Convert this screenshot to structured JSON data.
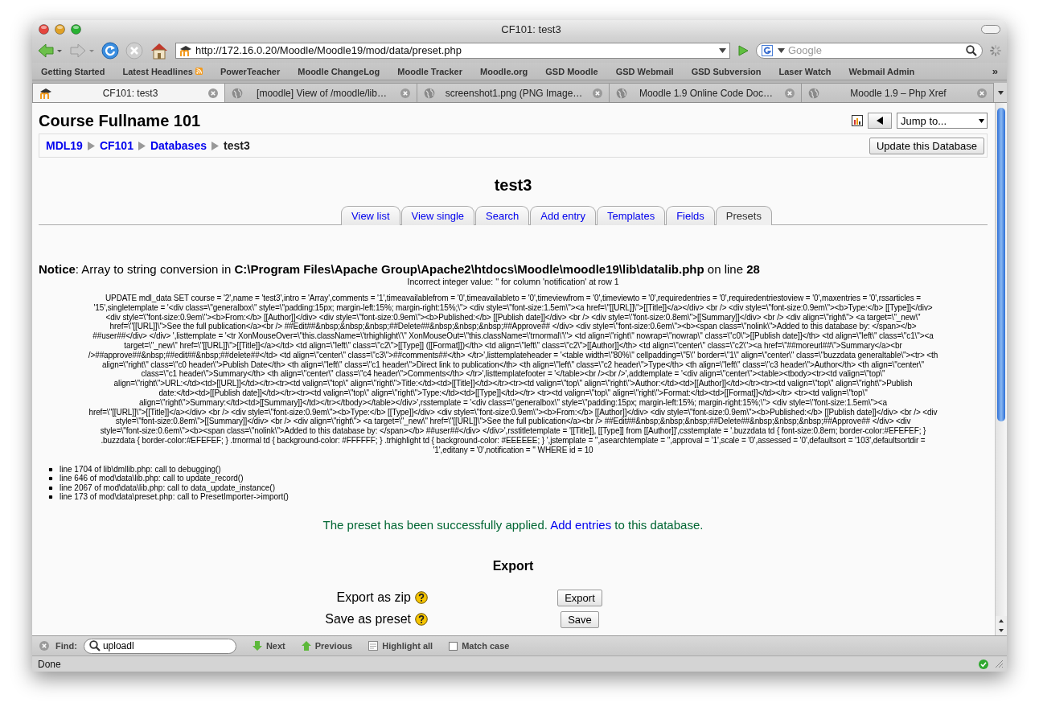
{
  "window": {
    "title": "CF101: test3"
  },
  "toolbar": {
    "url": "http://172.16.0.20/Moodle/Moodle19/mod/data/preset.php",
    "search": {
      "placeholder": "Google"
    }
  },
  "bookmarks": [
    {
      "label": "Getting Started",
      "kind": "link"
    },
    {
      "label": "Latest Headlines",
      "kind": "feed"
    },
    {
      "label": "PowerTeacher",
      "kind": "link"
    },
    {
      "label": "Moodle ChangeLog",
      "kind": "link"
    },
    {
      "label": "Moodle Tracker",
      "kind": "link"
    },
    {
      "label": "Moodle.org",
      "kind": "link"
    },
    {
      "label": "GSD Moodle",
      "kind": "link"
    },
    {
      "label": "GSD Webmail",
      "kind": "link"
    },
    {
      "label": "GSD Subversion",
      "kind": "link"
    },
    {
      "label": "Laser Watch",
      "kind": "link"
    },
    {
      "label": "Webmail Admin",
      "kind": "link"
    }
  ],
  "bookmarks_more": "»",
  "tabs": [
    {
      "title": "CF101: test3",
      "kind": "site",
      "selected": true
    },
    {
      "title": "[moodle] View of /moodle/lib…",
      "kind": "globe",
      "selected": false
    },
    {
      "title": "screenshot1.png (PNG Image…",
      "kind": "globe",
      "selected": false
    },
    {
      "title": "Moodle 1.9 Online Code Doc…",
      "kind": "globe",
      "selected": false
    },
    {
      "title": "Moodle 1.9 – Php Xref",
      "kind": "globe",
      "selected": false
    }
  ],
  "page": {
    "heading": "Course Fullname 101",
    "jump_select": "Jump to...",
    "update_button": "Update this Database",
    "breadcrumb": [
      {
        "label": "MDL19",
        "kind": "link"
      },
      {
        "label": "CF101",
        "kind": "link"
      },
      {
        "label": "Databases",
        "kind": "link"
      },
      {
        "label": "test3",
        "kind": "current"
      }
    ],
    "title": "test3",
    "module_tabs": [
      {
        "label": "View list",
        "selected": false
      },
      {
        "label": "View single",
        "selected": false
      },
      {
        "label": "Search",
        "selected": false
      },
      {
        "label": "Add entry",
        "selected": false
      },
      {
        "label": "Templates",
        "selected": false
      },
      {
        "label": "Fields",
        "selected": false
      },
      {
        "label": "Presets",
        "selected": true
      }
    ],
    "notice": "**Notice**: Array to string conversion in **C:\\Program Files\\Apache Group\\Apache2\\htdocs\\Moodle\\moodle19\\lib\\datalib.php** on line **28**",
    "error_detail": "Incorrect integer value: '' for column 'notification' at row 1",
    "sql_lines": [
      "UPDATE mdl_data SET course = '2',name = 'test3',intro = 'Array',comments = '1',timeavailablefrom = '0',timeavailableto = '0',timeviewfrom = '0',timeviewto = '0',requiredentries = '0',requiredentriestoview = '0',maxentries = '0',rssarticles =",
      "'15',singletemplate = '<div class=\\\"generalbox\\\" style=\\\"padding:15px; margin-left:15%; margin-right:15%;\\\"> <div style=\\\"font-size:1.5em\\\"><a href=\\\"[[URL]]\\\">[[Title]]</a></div> <br /> <div style=\\\"font-size:0.9em\\\"><b>Type:</b> [[Type]]</div>",
      "<div style=\\\"font-size:0.9em\\\"><b>From:</b> [[Author]]</div> <div style=\\\"font-size:0.9em\\\"><b>Published:</b> [[Publish date]]</div> <br /> <div style=\\\"font-size:0.8em\\\">[[Summary]]</div> <br /> <div align=\\\"right\\\"> <a target=\\\"_new\\\"",
      "href=\\\"[[URL]]\\\">See the full publication</a><br /> ##Edit##&nbsp;&nbsp;&nbsp;##Delete##&nbsp;&nbsp;&nbsp;##Approve## </div> <div style=\\\"font-size:0.6em\\\"><b><span class=\\\"nolink\\\">Added to this database by: </span></b>",
      "##user##</div> </div> ',listtemplate = '<tr XonMouseOver=\\\"this.className=\\'trhighlight\\'\\\" XonMouseOut=\\\"this.className=\\'trnormal\\'\\\"> <td align=\\\"right\\\" nowrap=\\\"nowrap\\\" class=\\\"c0\\\">[[Publish date]]</th> <td align=\\\"left\\\" class=\\\"c1\\\"><a",
      "target=\\\"_new\\\" href=\\\"[[URL]]\\\">[[Title]]</a></td> <td align=\\\"left\\\" class=\\\"c2\\\">[[Type]] ([[Format]])</th> <td align=\\\"left\\\" class=\\\"c2\\\">[[Author]]</th> <td align=\\\"center\\\" class=\\\"c2\\\"><a href=\\\"##moreurl##\\\">Summary</a><br",
      "/>##approve##&nbsp;##edit##&nbsp;##delete##</td> <td align=\\\"center\\\" class=\\\"c3\\\">##comments##</th> </tr>',listtemplateheader = '<table width=\\\"80%\\\" cellpadding=\\\"5\\\" border=\\\"1\\\" align=\\\"center\\\" class=\\\"buzzdata generaltable\\\"><tr> <th",
      "align=\\\"right\\\" class=\\\"c0 header\\\">Publish Date</th> <th align=\\\"left\\\" class=\\\"c1 header\\\">Direct link to publication</th> <th align=\\\"left\\\" class=\\\"c2 header\\\">Type</th> <th align=\\\"left\\\" class=\\\"c3 header\\\">Author</th> <th align=\\\"center\\\"",
      "class=\\\"c1 header\\\">Summary</th> <th align=\\\"center\\\" class=\\\"c4 header\\\">Comments</th> </tr>',listtemplatefooter = '</table><br /><br />',addtemplate = '<div align=\\\"center\\\"><table><tbody><tr><td valign=\\\"top\\\"",
      "align=\\\"right\\\">URL:</td><td>[[URL]]</td></tr><tr><td valign=\\\"top\\\" align=\\\"right\\\">Title:</td><td>[[Title]]</td></tr><tr><td valign=\\\"top\\\" align=\\\"right\\\">Author:</td><td>[[Author]]</td></tr><tr><td valign=\\\"top\\\" align=\\\"right\\\">Publish",
      "date:</td><td>[[Publish date]]</td></tr><tr><td valign=\\\"top\\\" align=\\\"right\\\">Type:</td><td>[[Type]]</td></tr> <tr><td valign=\\\"top\\\" align=\\\"right\\\">Format:</td><td>[[Format]]</td></tr> <tr><td valign=\\\"top\\\"",
      "align=\\\"right\\\">Summary:</td><td>[[Summary]]</td></tr></tbody></table></div>',rsstemplate = '<div class=\\\"generalbox\\\" style=\\\"padding:15px; margin-left:15%; margin-right:15%;\\\"> <div style=\\\"font-size:1.5em\\\"><a",
      "href=\\\"[[URL]]\\\">[[Title]]</a></div> <br /> <div style=\\\"font-size:0.9em\\\"><b>Type:</b> [[Type]]</div> <div style=\\\"font-size:0.9em\\\"><b>From:</b> [[Author]]</div> <div style=\\\"font-size:0.9em\\\"><b>Published:</b> [[Publish date]]</div> <br /> <div",
      "style=\\\"font-size:0.8em\\\">[[Summary]]</div> <br /> <div align=\\\"right\\\"> <a target=\\\"_new\\\" href=\\\"[[URL]]\\\">See the full publication</a><br /> ##Edit##&nbsp;&nbsp;&nbsp;##Delete##&nbsp;&nbsp;&nbsp;##Approve## </div> <div",
      "style=\\\"font-size:0.6em\\\"><b><span class=\\\"nolink\\\">Added to this database by: </span></b> ##user##</div> </div>',rsstitletemplate = '[[Title]], [[Type]] from [[Author]]',csstemplate = '.buzzdata td { font-size:0.8em; border-color:#EFEFEF; }",
      ".buzzdata { border-color:#EFEFEF; } .trnormal td { background-color: #FFFFFF; } .trhighlight td { background-color: #EEEEEE; } ',jstemplate = '',asearchtemplate = '',approval = '1',scale = '0',assessed = '0',defaultsort = '103',defaultsortdir =",
      "'1',editany = '0',notification = '' WHERE id = 10"
    ],
    "backtrace": [
      "line 1704 of lib\\dmllib.php: call to debugging()",
      "line 646 of mod\\data\\lib.php: call to update_record()",
      "line 2067 of mod\\data\\lib.php: call to data_update_instance()",
      "line 173 of mod\\data\\preset.php: call to PresetImporter->import()"
    ],
    "success": {
      "before": "The preset has been successfully applied.",
      "link": "Add entries",
      "after": "to this database."
    },
    "export": {
      "heading": "Export",
      "rows": [
        {
          "label": "Export as zip",
          "button": "Export"
        },
        {
          "label": "Save as preset",
          "button": "Save"
        }
      ]
    }
  },
  "find_bar": {
    "label": "Find:",
    "value": "uploadl",
    "next": "Next",
    "previous": "Previous",
    "highlight": "Highlight all",
    "match_case": {
      "label": "Match case",
      "checked": false
    }
  },
  "status": "Done"
}
